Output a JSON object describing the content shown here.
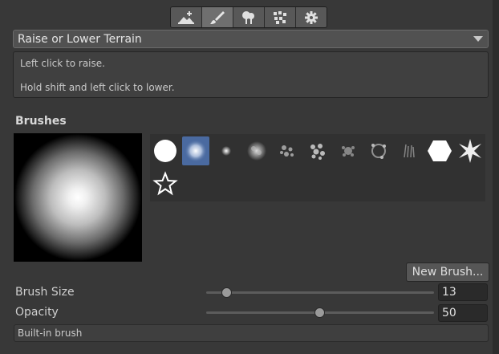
{
  "toolbar": {
    "tools": [
      {
        "name": "create-neighbor-terrains",
        "icon": "terrain-plus-icon"
      },
      {
        "name": "paint-terrain",
        "icon": "paintbrush-icon",
        "active": true
      },
      {
        "name": "paint-trees",
        "icon": "trees-icon"
      },
      {
        "name": "paint-details",
        "icon": "details-icon"
      },
      {
        "name": "terrain-settings",
        "icon": "gear-icon"
      }
    ]
  },
  "tool_select": {
    "value": "Raise or Lower Terrain"
  },
  "help": {
    "line1": "Left click to raise.",
    "line2": "Hold shift and left click to lower."
  },
  "brushes": {
    "title": "Brushes",
    "selected_index": 1
  },
  "new_brush_label": "New Brush...",
  "brush_size": {
    "label": "Brush Size",
    "value": "13",
    "fraction": 0.09
  },
  "opacity": {
    "label": "Opacity",
    "value": "50",
    "fraction": 0.5
  },
  "brush_source": "Built-in brush",
  "colors": {
    "accent": "#4a6aa0",
    "background": "#383838"
  }
}
